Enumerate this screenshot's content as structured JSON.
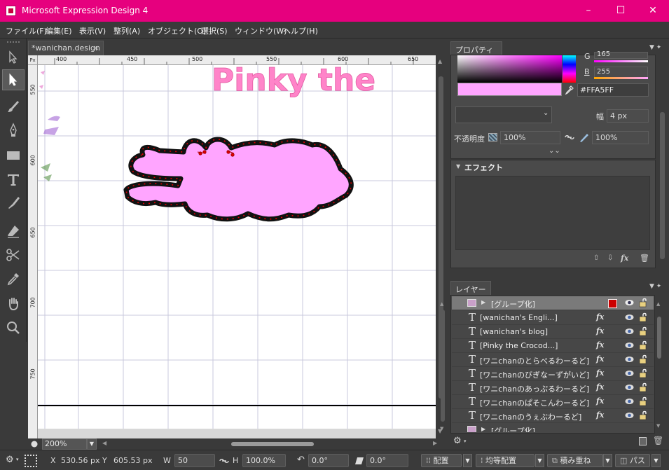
{
  "window": {
    "title": "Microsoft Expression Design 4",
    "minimize": "–",
    "maximize": "☐",
    "close": "✕"
  },
  "menu": [
    "ファイル(F)",
    "編集(E)",
    "表示(V)",
    "整列(A)",
    "オブジェクト(O)",
    "選択(S)",
    "ウィンドウ(W)",
    "ヘルプ(H)"
  ],
  "tools": [
    "selection-arrow",
    "direct-selection",
    "brush",
    "pen",
    "rectangle",
    "text",
    "paint-bucket",
    "eraser",
    "scissors",
    "eyedropper",
    "hand",
    "zoom"
  ],
  "document": {
    "tab_title": "*wanichan.design",
    "tab_close": "×",
    "ruler_unit": "Px",
    "hruler_labels": [
      "400",
      "450",
      "500",
      "550",
      "600",
      "650"
    ],
    "vruler_labels": [
      "550",
      "600",
      "650",
      "700",
      "750"
    ],
    "canvas_text": "Pinky the",
    "zoom": "200%"
  },
  "properties_panel": {
    "title": "プロパティ(P)",
    "g_label": "G",
    "g_value": "165",
    "b_label": "B",
    "b_value": "255",
    "hex": "#FFA5FF",
    "width_label": "幅",
    "width_value": "4 px",
    "opacity_label": "不透明度",
    "opacity_value": "100%",
    "opacity_value2": "100%",
    "swatch_color": "#FFA5FF"
  },
  "effects_panel": {
    "title": "エフェクト"
  },
  "layers_panel": {
    "title": "レイヤー(L)",
    "top_group": "[グループ化]",
    "items": [
      "[wanichan's Engli...]",
      "[wanichan's blog]",
      "[Pinky the Crocod...]",
      "[ワニchanのとらべるわーるど]",
      "[ワニchanのびぎなーずがいど]",
      "[ワニchanのあっぷるわーるど]",
      "[ワニchanのぱそこんわーるど]",
      "[ワニchanのうぇぶわーるど]"
    ],
    "bottom_group": "[グループ化]",
    "fx": "fx"
  },
  "statusbar": {
    "x_label": "X",
    "x_value": "530.56 px",
    "y_label": "Y",
    "y_value": "605.53 px",
    "w_label": "W",
    "w_value": "50",
    "h_label": "H",
    "h_value": "100.0%",
    "rotation_value": "0.0°",
    "skew_value": "0.0°",
    "arrange_button": "配置",
    "distribute_button": "均等配置",
    "stack_button": "積み重ね",
    "path_button": "パス"
  }
}
